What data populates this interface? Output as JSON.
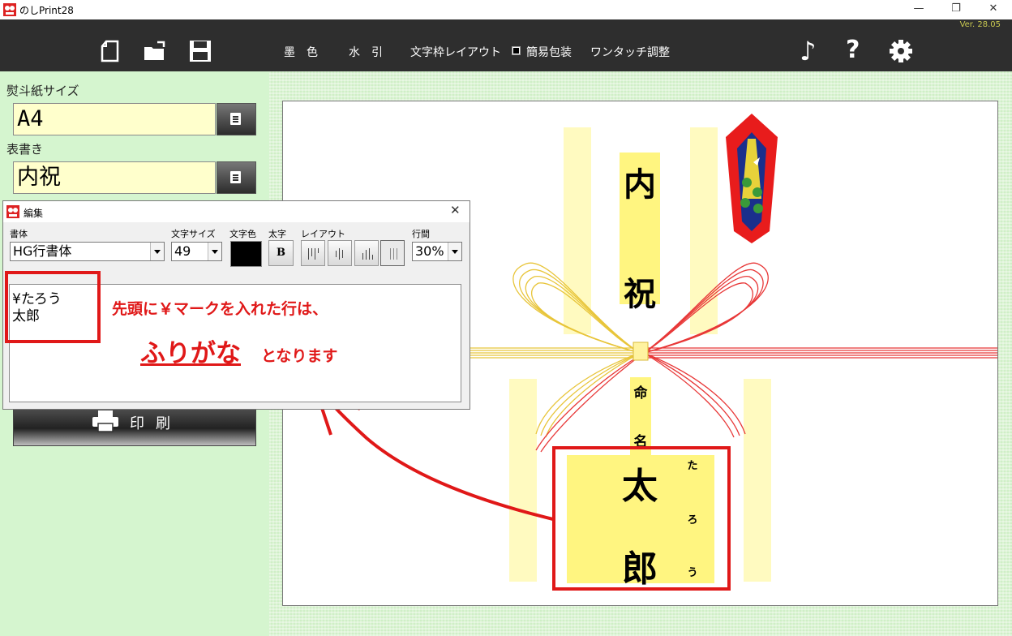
{
  "window": {
    "title": "のしPrint28",
    "version": "Ver. 28.05"
  },
  "toolbar": {
    "menu": [
      "墨　色",
      "水　引",
      "文字枠レイアウト",
      "簡易包装",
      "ワンタッチ調整"
    ],
    "simple_wrap_checked": true,
    "icons": [
      "new-file-icon",
      "open-folder-icon",
      "save-icon",
      "music-note-icon",
      "help-icon",
      "gear-icon"
    ]
  },
  "left_panel": {
    "paper_size_label": "熨斗紙サイズ",
    "paper_size_value": "A4",
    "omote_label": "表書き",
    "omote_value": "内祝",
    "print_label": "印刷"
  },
  "dialog": {
    "title": "編集",
    "font_label": "書体",
    "font_value": "HG行書体",
    "size_label": "文字サイズ",
    "size_value": "49",
    "color_label": "文字色",
    "color_value": "#000000",
    "bold_label": "太字",
    "bold_button": "B",
    "layout_label": "レイアウト",
    "spacing_label": "行間",
    "spacing_value": "30%",
    "text_lines": [
      "¥たろう",
      "太郎"
    ]
  },
  "annotation": {
    "line1": "先頭に￥マークを入れた行は、",
    "furigana": "ふりがな",
    "line2": "となります"
  },
  "noshi": {
    "top_text": [
      "内",
      "祝"
    ],
    "naming_text": [
      "命",
      "名"
    ],
    "name": [
      "太",
      "郎"
    ],
    "furigana": [
      "た",
      "ろ",
      "う"
    ]
  },
  "colors": {
    "toolbar_bg": "#2e2e2e",
    "panel_bg": "#d5f5cf",
    "field_bg": "#ffffcc",
    "annotation_red": "#e01818",
    "mizuhiki_gold": "#e8c53a",
    "mizuhiki_red": "#e83838"
  }
}
